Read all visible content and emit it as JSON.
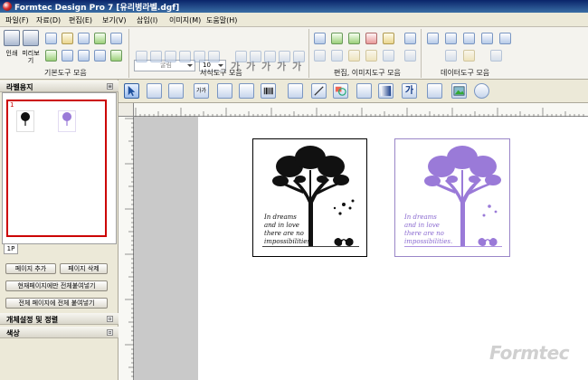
{
  "window": {
    "title": "Formtec Design Pro 7 [유리병라벨.dgf]"
  },
  "menu": [
    {
      "label": "파일(F)"
    },
    {
      "label": "자료(D)"
    },
    {
      "label": "편집(E)"
    },
    {
      "label": "보기(V)"
    },
    {
      "label": "삽입(I)"
    },
    {
      "label": "이미지(M)"
    },
    {
      "label": "도움말(H)"
    }
  ],
  "toolbar": {
    "print_label": "인쇄",
    "preview_label": "미리보기",
    "groups": [
      {
        "label": "기본도구 모음"
      },
      {
        "label": "서식도구 모음"
      },
      {
        "label": "편집, 이미지도구 모음"
      },
      {
        "label": "데이터도구 모음"
      }
    ],
    "font_name": "굴림",
    "font_size": "10",
    "format_glyphs": [
      "가",
      "가",
      "가",
      "가",
      "가"
    ]
  },
  "left_panel": {
    "sheet_header": "라벨용지",
    "page_number": "1",
    "page_tab": "1P",
    "buttons": {
      "add_page": "페이지 추가",
      "delete_page": "페이지 삭제",
      "paste_all_current": "현재페이지에만 전체붙여넣기",
      "paste_all_pages": "전체 페이지에 전체 붙여넣기"
    },
    "object_settings_header": "개체설정 및 정렬",
    "color_header": "색상"
  },
  "design_toolbar": {
    "text_glyph": "가",
    "text_glyph_2": "가",
    "letter_spacing_glyph": "가가"
  },
  "labels": [
    {
      "quote": [
        "In dreams",
        "and in love",
        "there are no",
        "impossibilities."
      ],
      "color": "#111111"
    },
    {
      "quote": [
        "In dreams",
        "and in love",
        "there are no",
        "impossibilities."
      ],
      "color": "#8a6ad0"
    }
  ],
  "watermark": "Formtec"
}
